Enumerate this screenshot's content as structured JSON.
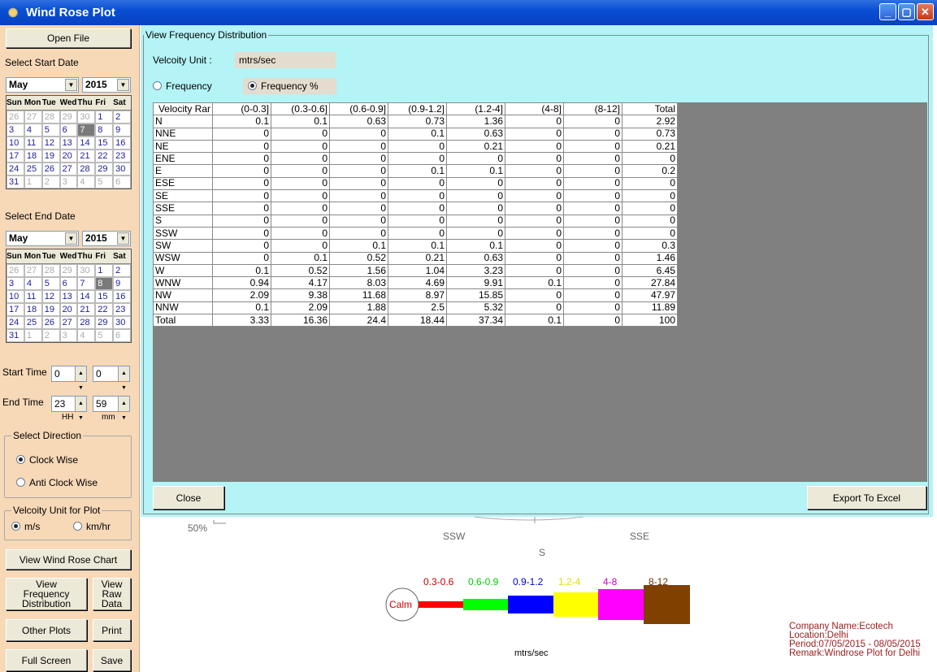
{
  "window": {
    "title": "Wind Rose Plot",
    "buttons": {
      "min": "_",
      "max": "▢",
      "close": "✕"
    }
  },
  "sidebar": {
    "open_file": "Open File",
    "start_date_label": "Select Start Date",
    "start_month": "May",
    "start_year": "2015",
    "end_date_label": "Select End Date",
    "end_month": "May",
    "end_year": "2015",
    "weekday_headers": [
      "Sun",
      "Mon",
      "Tue",
      "Wed",
      "Thu",
      "Fri",
      "Sat"
    ],
    "start_calendar": [
      [
        "26",
        "27",
        "28",
        "29",
        "30",
        "1",
        "2"
      ],
      [
        "3",
        "4",
        "5",
        "6",
        "7",
        "8",
        "9"
      ],
      [
        "10",
        "11",
        "12",
        "13",
        "14",
        "15",
        "16"
      ],
      [
        "17",
        "18",
        "19",
        "20",
        "21",
        "22",
        "23"
      ],
      [
        "24",
        "25",
        "26",
        "27",
        "28",
        "29",
        "30"
      ],
      [
        "31",
        "1",
        "2",
        "3",
        "4",
        "5",
        "6"
      ]
    ],
    "end_calendar": [
      [
        "26",
        "27",
        "28",
        "29",
        "30",
        "1",
        "2"
      ],
      [
        "3",
        "4",
        "5",
        "6",
        "7",
        "8",
        "9"
      ],
      [
        "10",
        "11",
        "12",
        "13",
        "14",
        "15",
        "16"
      ],
      [
        "17",
        "18",
        "19",
        "20",
        "21",
        "22",
        "23"
      ],
      [
        "24",
        "25",
        "26",
        "27",
        "28",
        "29",
        "30"
      ],
      [
        "31",
        "1",
        "2",
        "3",
        "4",
        "5",
        "6"
      ]
    ],
    "start_selected": "7",
    "end_selected": "8",
    "start_time_label": "Start Time",
    "start_hh": "0",
    "start_mm": "0",
    "end_time_label": "End Time",
    "end_hh": "23",
    "end_mm": "59",
    "hh_label": "HH",
    "mm_label": "mm",
    "direction_group": "Select Direction",
    "clockwise": "Clock Wise",
    "anticlockwise": "Anti Clock Wise",
    "unit_group": "Velcoity Unit for Plot",
    "unit_ms": "m/s",
    "unit_kmhr": "km/hr",
    "view_chart": "View Wind Rose Chart",
    "view_freq": "View Frequency Distribution",
    "view_raw": "View Raw Data",
    "other_plots": "Other Plots",
    "print": "Print",
    "full_screen": "Full Screen",
    "save": "Save"
  },
  "panel": {
    "group_title": "View Frequency Distribution",
    "velocity_unit_label": "Velcoity Unit :",
    "velocity_unit_value": "mtrs/sec",
    "radio_frequency": "Frequency",
    "radio_frequency_pct": "Frequency %",
    "close": "Close",
    "export": "Export To Excel"
  },
  "table": {
    "headers": [
      "Velocity Rar",
      "(0-0.3]",
      "(0.3-0.6]",
      "(0.6-0.9]",
      "(0.9-1.2]",
      "(1.2-4]",
      "(4-8]",
      "(8-12]",
      "Total"
    ],
    "rows": [
      [
        "N",
        "0.1",
        "0.1",
        "0.63",
        "0.73",
        "1.36",
        "0",
        "0",
        "2.92"
      ],
      [
        "NNE",
        "0",
        "0",
        "0",
        "0.1",
        "0.63",
        "0",
        "0",
        "0.73"
      ],
      [
        "NE",
        "0",
        "0",
        "0",
        "0",
        "0.21",
        "0",
        "0",
        "0.21"
      ],
      [
        "ENE",
        "0",
        "0",
        "0",
        "0",
        "0",
        "0",
        "0",
        "0"
      ],
      [
        "E",
        "0",
        "0",
        "0",
        "0.1",
        "0.1",
        "0",
        "0",
        "0.2"
      ],
      [
        "ESE",
        "0",
        "0",
        "0",
        "0",
        "0",
        "0",
        "0",
        "0"
      ],
      [
        "SE",
        "0",
        "0",
        "0",
        "0",
        "0",
        "0",
        "0",
        "0"
      ],
      [
        "SSE",
        "0",
        "0",
        "0",
        "0",
        "0",
        "0",
        "0",
        "0"
      ],
      [
        "S",
        "0",
        "0",
        "0",
        "0",
        "0",
        "0",
        "0",
        "0"
      ],
      [
        "SSW",
        "0",
        "0",
        "0",
        "0",
        "0",
        "0",
        "0",
        "0"
      ],
      [
        "SW",
        "0",
        "0",
        "0.1",
        "0.1",
        "0.1",
        "0",
        "0",
        "0.3"
      ],
      [
        "WSW",
        "0",
        "0.1",
        "0.52",
        "0.21",
        "0.63",
        "0",
        "0",
        "1.46"
      ],
      [
        "W",
        "0.1",
        "0.52",
        "1.56",
        "1.04",
        "3.23",
        "0",
        "0",
        "6.45"
      ],
      [
        "WNW",
        "0.94",
        "4.17",
        "8.03",
        "4.69",
        "9.91",
        "0.1",
        "0",
        "27.84"
      ],
      [
        "NW",
        "2.09",
        "9.38",
        "11.68",
        "8.97",
        "15.85",
        "0",
        "0",
        "47.97"
      ],
      [
        "NNW",
        "0.1",
        "2.09",
        "1.88",
        "2.5",
        "5.32",
        "0",
        "0",
        "11.89"
      ],
      [
        "Total",
        "3.33",
        "16.36",
        "24.4",
        "18.44",
        "37.34",
        "0.1",
        "0",
        "100"
      ]
    ]
  },
  "chart": {
    "pct_label": "50%",
    "ssw": "SSW",
    "sse": "SSE",
    "s": "S",
    "calm": "Calm",
    "legend": [
      {
        "label": "0.3-0.6",
        "color": "#ff0000"
      },
      {
        "label": "0.6-0.9",
        "color": "#00ff00"
      },
      {
        "label": "0.9-1.2",
        "color": "#0000ff"
      },
      {
        "label": "1.2-4",
        "color": "#ffff00"
      },
      {
        "label": "4-8",
        "color": "#ff00ff"
      },
      {
        "label": "8-12",
        "color": "#804000"
      }
    ],
    "legend_text_colors": [
      "#cc0000",
      "#00cc00",
      "#0000cc",
      "#e0e000",
      "#cc00cc",
      "#663300"
    ],
    "unit": "mtrs/sec",
    "info": [
      "Company Name:Ecotech",
      "Location:Delhi",
      "Period:07/05/2015 - 08/05/2015",
      "Remark:Windrose Plot for Delhi"
    ]
  }
}
